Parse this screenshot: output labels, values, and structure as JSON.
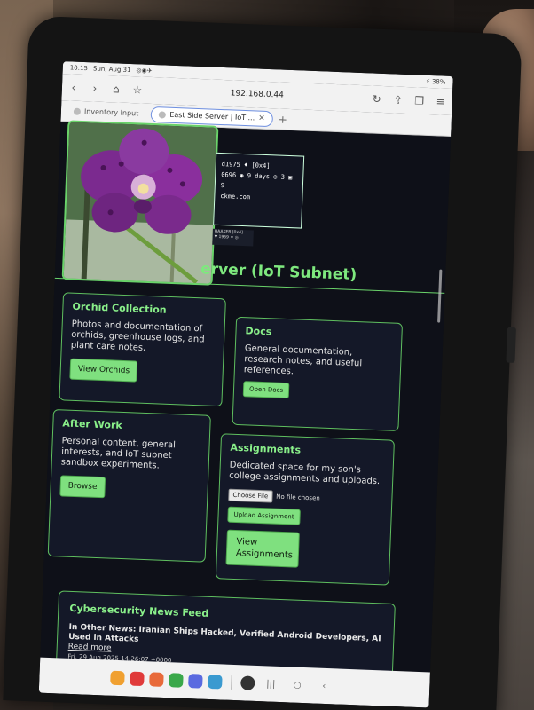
{
  "status": {
    "time": "10:15",
    "date": "Sun, Aug 31",
    "battery": "38%"
  },
  "browser": {
    "url": "192.168.0.44",
    "tabs": [
      {
        "label": "Inventory Input",
        "active": false
      },
      {
        "label": "East Side Server | IoT ...",
        "active": true
      }
    ]
  },
  "stats_card": {
    "line1": "d1975 ♦ [0x4]",
    "line2": "0696 ◉ 9 days ◎ 3 ▣ 9",
    "line3": "ckme.com"
  },
  "stats_mini": {
    "line1": "HAAKER [0x4]",
    "line2": "▼ 1969 ♦ ◎"
  },
  "site": {
    "title_fragment": "erver (IoT Subnet)"
  },
  "cards": {
    "orchid": {
      "title": "Orchid Collection",
      "desc": "Photos and documentation of orchids, greenhouse logs, and plant care notes.",
      "button": "View Orchids"
    },
    "docs": {
      "title": "Docs",
      "desc": "General documentation, research notes, and useful references.",
      "button": "Open Docs"
    },
    "afterwork": {
      "title": "After Work",
      "desc": "Personal content, general interests, and IoT subnet sandbox experiments.",
      "button": "Browse"
    },
    "assignments": {
      "title": "Assignments",
      "desc": "Dedicated space for my son's college assignments and uploads.",
      "choose_file": "Choose File",
      "no_file": "No file chosen",
      "upload": "Upload Assignment",
      "view": "View Assignments"
    }
  },
  "news": {
    "title": "Cybersecurity News Feed",
    "headline": "In Other News: Iranian Ships Hacked, Verified Android Developers, AI Used in Attacks",
    "read_more": "Read more",
    "date": "Fri, 29 Aug 2025 14:26:07 +0000"
  },
  "colors": {
    "accent": "#7fe07f",
    "card_bg": "#141828",
    "page_bg": "#0e1018"
  }
}
